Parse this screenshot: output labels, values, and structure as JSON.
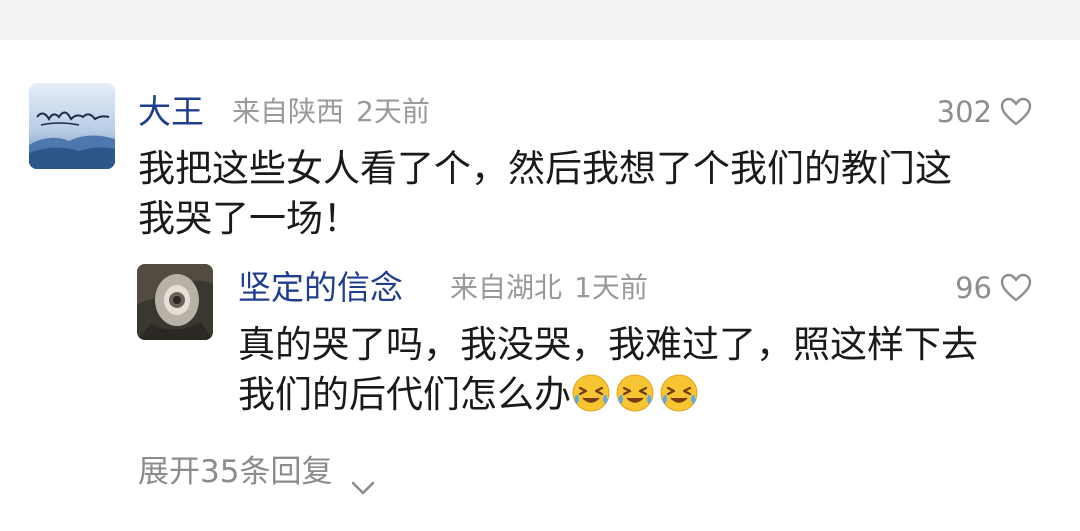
{
  "comment": {
    "user": "大王",
    "location": "来自陕西",
    "time": "2天前",
    "likes": "302",
    "text_lines": [
      "我把这些女人看了个，然后我想了个我们的教门这",
      "我哭了一场！"
    ],
    "reply": {
      "user": "坚定的信念",
      "location": "来自湖北",
      "time": "1天前",
      "likes": "96",
      "text_lines": [
        "真的哭了吗，我没哭，我难过了，照这样下去",
        "我们的后代们怎么办"
      ],
      "emojis": [
        "crying-laugh-emoji",
        "crying-laugh-emoji",
        "crying-laugh-emoji"
      ]
    }
  },
  "expand_label": "展开35条回复",
  "colors": {
    "username": "#1f3f8e",
    "meta": "#9a9a9a",
    "text": "#1a1a1a",
    "top_band": "#f3f3f5"
  }
}
